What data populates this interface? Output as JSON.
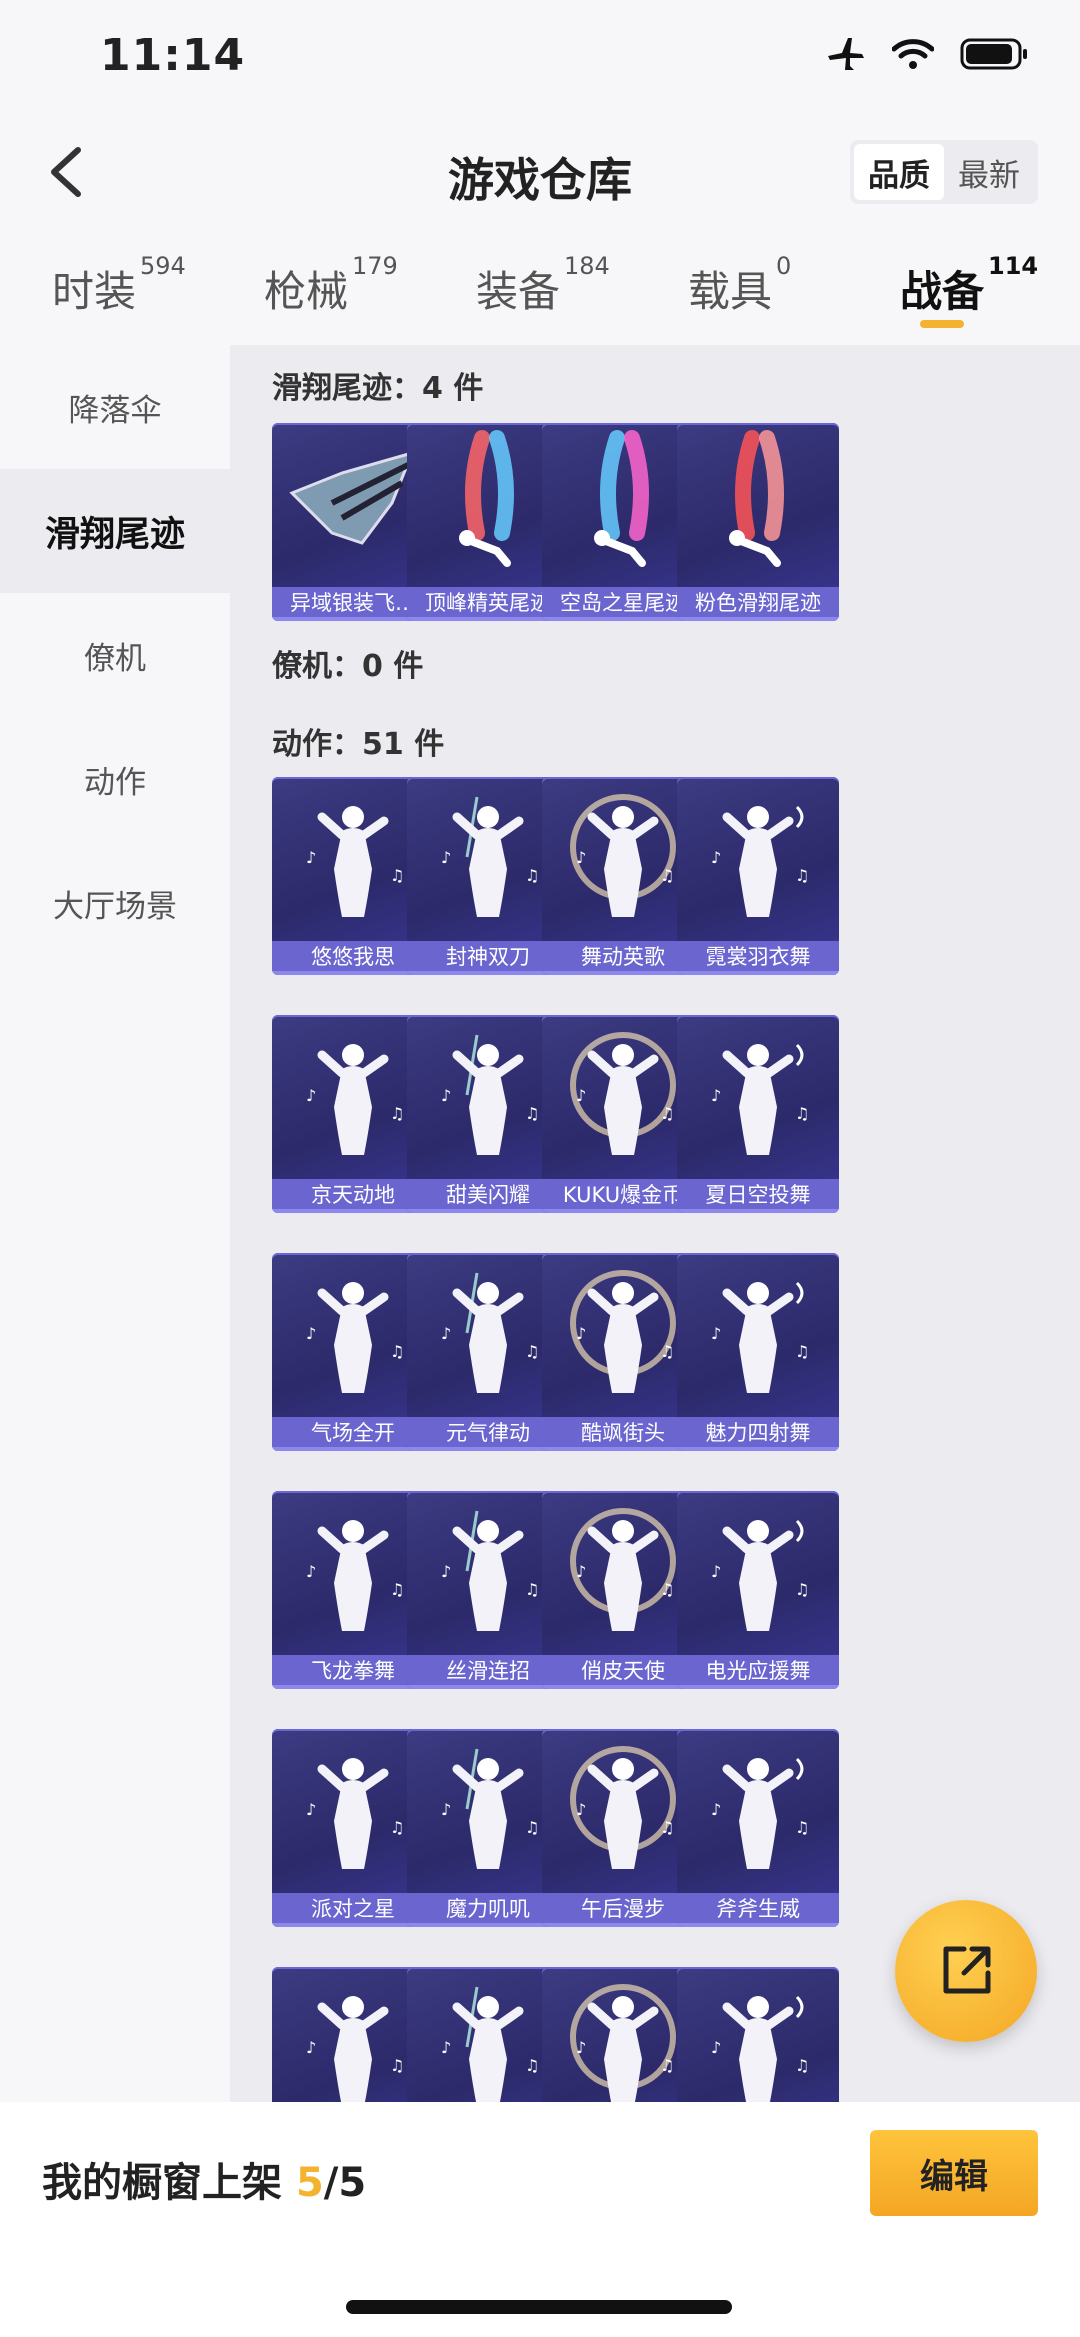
{
  "status": {
    "time": "11:14"
  },
  "nav": {
    "title": "游戏仓库",
    "sort_options": [
      "品质",
      "最新"
    ],
    "sort_selected": "品质"
  },
  "tabs": [
    {
      "label": "时装",
      "count": "594",
      "active": false
    },
    {
      "label": "枪械",
      "count": "179",
      "active": false
    },
    {
      "label": "装备",
      "count": "184",
      "active": false
    },
    {
      "label": "载具",
      "count": "0",
      "active": false
    },
    {
      "label": "战备",
      "count": "114",
      "active": true
    }
  ],
  "sidebar": {
    "items": [
      {
        "label": "降落伞",
        "active": false
      },
      {
        "label": "滑翔尾迹",
        "active": true
      },
      {
        "label": "僚机",
        "active": false
      },
      {
        "label": "动作",
        "active": false
      },
      {
        "label": "大厅场景",
        "active": false
      }
    ]
  },
  "sections": {
    "glide": {
      "title": "滑翔尾迹：4 件",
      "items": [
        "异域银装飞…",
        "顶峰精英尾迹",
        "空岛之星尾迹",
        "粉色滑翔尾迹"
      ]
    },
    "wingman": {
      "title": "僚机：0 件"
    },
    "emote": {
      "title": "动作：51 件",
      "items": [
        "悠悠我思",
        "封神双刀",
        "舞动英歌",
        "霓裳羽衣舞",
        "京天动地",
        "甜美闪耀",
        "KUKU爆金币",
        "夏日空投舞",
        "气场全开",
        "元气律动",
        "酷飒街头",
        "魅力四射舞",
        "飞龙拳舞",
        "丝滑连招",
        "俏皮天使",
        "电光应援舞",
        "派对之星",
        "魔力叽叽",
        "午后漫步",
        "斧斧生威",
        "",
        "",
        "",
        ""
      ]
    }
  },
  "bottom": {
    "label": "我的橱窗上架 ",
    "used": "5",
    "total": "/5",
    "edit_label": "编辑"
  },
  "colors": {
    "accent": "#f4b32f",
    "card_bg": "#2c2a6a",
    "card_bar": "#6b66cf"
  }
}
